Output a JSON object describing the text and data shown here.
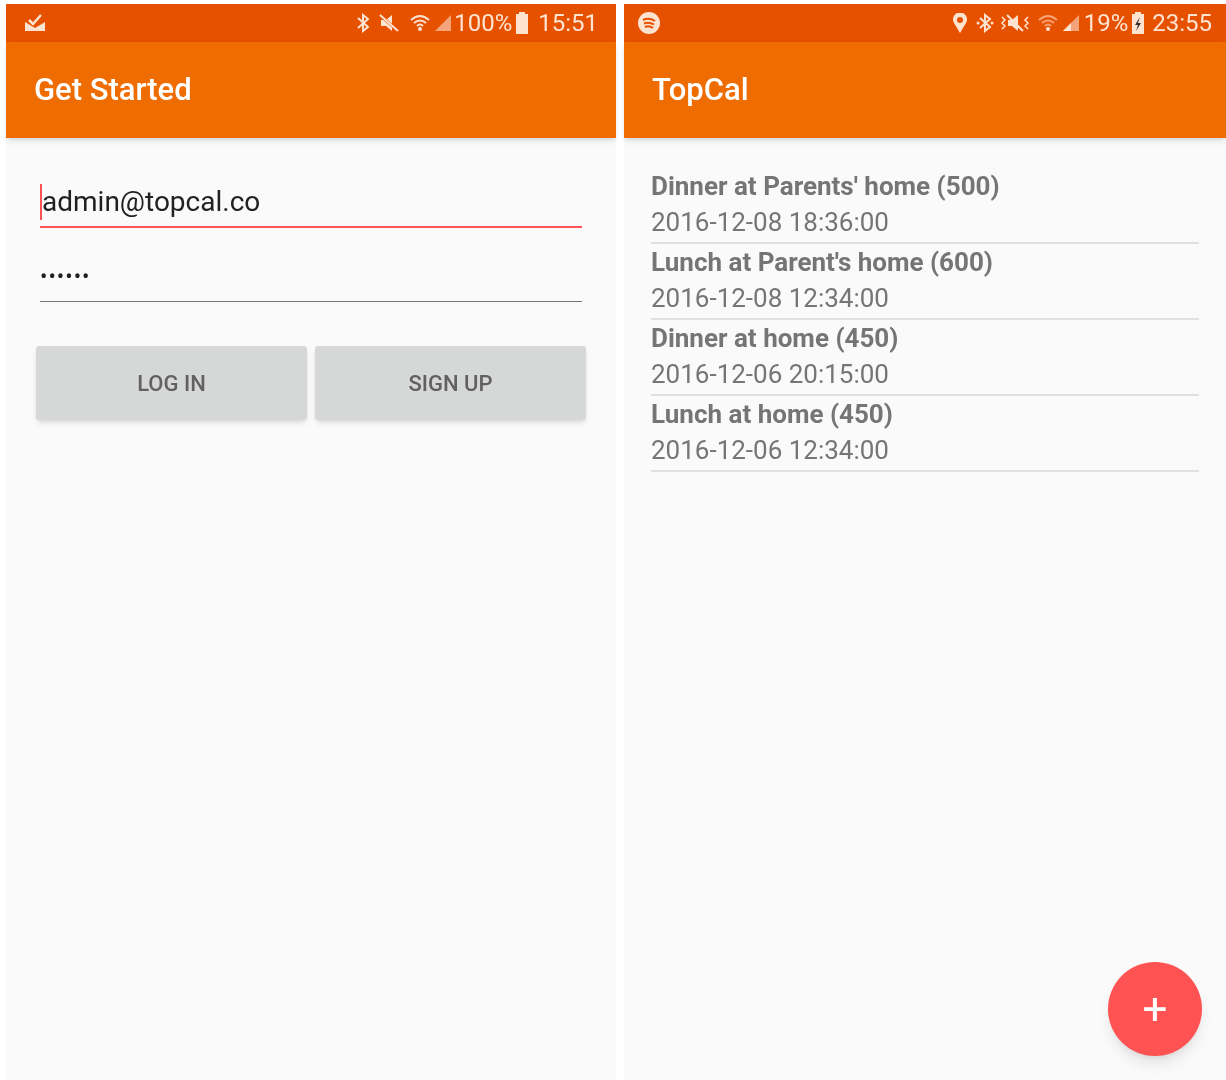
{
  "login_screen": {
    "status_bar": {
      "battery": "100%",
      "time": "15:51"
    },
    "app_bar": {
      "title": "Get Started"
    },
    "fields": [
      {
        "kind": "email",
        "value": "admin@topcal.co",
        "focused": true
      },
      {
        "kind": "password",
        "value": "••••••",
        "focused": false
      }
    ],
    "buttons": [
      "LOG IN",
      "SIGN UP"
    ]
  },
  "list_screen": {
    "status_bar": {
      "battery": "19%",
      "time": "23:55"
    },
    "app_bar": {
      "title": "TopCal"
    },
    "entries": [
      {
        "title": "Dinner at Parents' home (500)",
        "time": "2016-12-08 18:36:00"
      },
      {
        "title": "Lunch at Parent's home (600)",
        "time": "2016-12-08 12:34:00"
      },
      {
        "title": "Dinner at home (450)",
        "time": "2016-12-06 20:15:00"
      },
      {
        "title": "Lunch at home (450)",
        "time": "2016-12-06 12:34:00"
      }
    ],
    "fab": "+"
  }
}
